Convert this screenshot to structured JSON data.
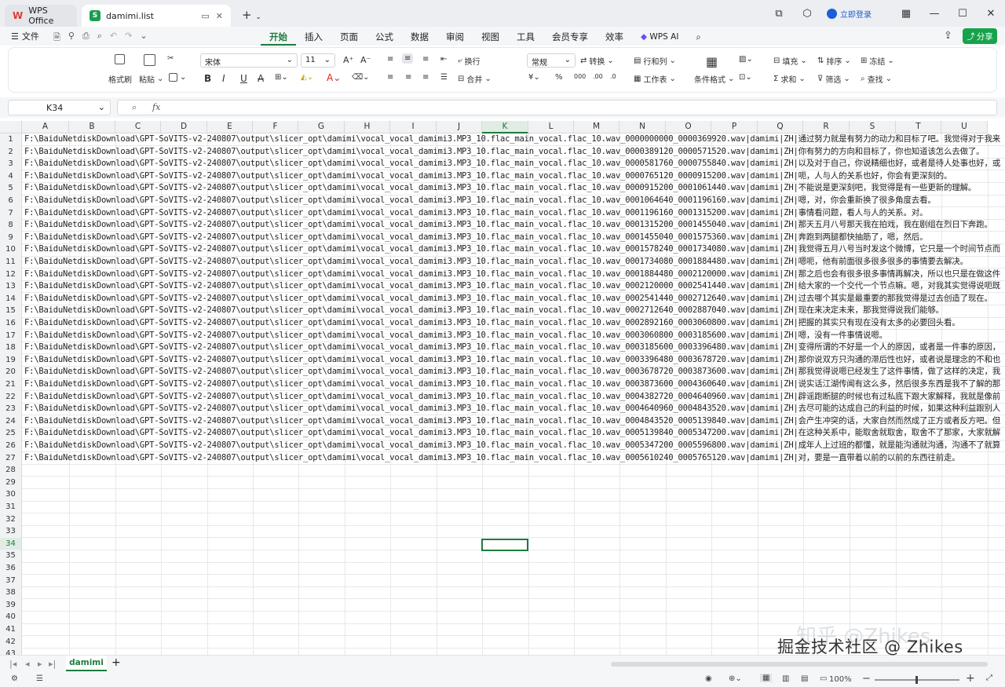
{
  "titlebar": {
    "wps_tab": "WPS Office",
    "doc_tab": "damimi.list",
    "login": "立即登录"
  },
  "menubar": {
    "file": "文件",
    "tabs": [
      "开始",
      "插入",
      "页面",
      "公式",
      "数据",
      "审阅",
      "视图",
      "工具",
      "会员专享",
      "效率",
      "WPS AI"
    ],
    "share": "分享"
  },
  "ribbon": {
    "format_painter": "格式刷",
    "paste": "粘贴",
    "font_name": "宋体",
    "font_size": "11",
    "wrap": "换行",
    "merge": "合并",
    "number_format": "常规",
    "convert": "转换",
    "row_col": "行和列",
    "worksheet": "工作表",
    "cond_format": "条件格式",
    "fill": "填充",
    "sort": "排序",
    "freeze": "冻结",
    "sum": "求和",
    "filter": "筛选",
    "find": "查找"
  },
  "formula_bar": {
    "name_box": "K34",
    "fx": "fx",
    "value": ""
  },
  "columns": [
    "A",
    "B",
    "C",
    "D",
    "E",
    "F",
    "G",
    "H",
    "I",
    "J",
    "K",
    "L",
    "M",
    "N",
    "O",
    "P",
    "Q",
    "R",
    "S",
    "T",
    "U"
  ],
  "selected_column": "K",
  "selected_row": 34,
  "rows": [
    "F:\\BaiduNetdiskDownload\\GPT-SoVITS-v2-240807\\output\\slicer_opt\\damimi\\vocal_vocal_damimi3.MP3_10.flac_main_vocal.flac_10.wav_0000000000_0000369920.wav|damimi|ZH|通过努力就是有努力的动力和目标了吧。我觉得对于我来",
    "F:\\BaiduNetdiskDownload\\GPT-SoVITS-v2-240807\\output\\slicer_opt\\damimi\\vocal_vocal_damimi3.MP3_10.flac_main_vocal.flac_10.wav_0000389120_0000571520.wav|damimi|ZH|你有努力的方向和目标了，你也知道该怎么去做了。",
    "F:\\BaiduNetdiskDownload\\GPT-SoVITS-v2-240807\\output\\slicer_opt\\damimi\\vocal_vocal_damimi3.MP3_10.flac_main_vocal.flac_10.wav_0000581760_0000755840.wav|damimi|ZH|以及对于自己，你说精细也好，或者是待人处事也好，或",
    "F:\\BaiduNetdiskDownload\\GPT-SoVITS-v2-240807\\output\\slicer_opt\\damimi\\vocal_vocal_damimi3.MP3_10.flac_main_vocal.flac_10.wav_0000765120_0000915200.wav|damimi|ZH|呃，人与人的关系也好，你会有更深刻的。",
    "F:\\BaiduNetdiskDownload\\GPT-SoVITS-v2-240807\\output\\slicer_opt\\damimi\\vocal_vocal_damimi3.MP3_10.flac_main_vocal.flac_10.wav_0000915200_0001061440.wav|damimi|ZH|不能说是更深刻吧，我觉得是有一些更新的理解。",
    "F:\\BaiduNetdiskDownload\\GPT-SoVITS-v2-240807\\output\\slicer_opt\\damimi\\vocal_vocal_damimi3.MP3_10.flac_main_vocal.flac_10.wav_0001064640_0001196160.wav|damimi|ZH|嗯，对，你会重新换了很多角度去看。",
    "F:\\BaiduNetdiskDownload\\GPT-SoVITS-v2-240807\\output\\slicer_opt\\damimi\\vocal_vocal_damimi3.MP3_10.flac_main_vocal.flac_10.wav_0001196160_0001315200.wav|damimi|ZH|事情看问题，看人与人的关系。对。",
    "F:\\BaiduNetdiskDownload\\GPT-SoVITS-v2-240807\\output\\slicer_opt\\damimi\\vocal_vocal_damimi3.MP3_10.flac_main_vocal.flac_10.wav_0001315200_0001455040.wav|damimi|ZH|那天五月八号那天我在拍戏，我在剧组在烈日下奔跑。",
    "F:\\BaiduNetdiskDownload\\GPT-SoVITS-v2-240807\\output\\slicer_opt\\damimi\\vocal_vocal_damimi3.MP3_10.flac_main_vocal.flac_10.wav_0001455040_0001575360.wav|damimi|ZH|奔跑到两腿都快抽筋了，嗯，然后。",
    "F:\\BaiduNetdiskDownload\\GPT-SoVITS-v2-240807\\output\\slicer_opt\\damimi\\vocal_vocal_damimi3.MP3_10.flac_main_vocal.flac_10.wav_0001578240_0001734080.wav|damimi|ZH|我觉得五月八号当时发这个微博，它只是一个时间节点而",
    "F:\\BaiduNetdiskDownload\\GPT-SoVITS-v2-240807\\output\\slicer_opt\\damimi\\vocal_vocal_damimi3.MP3_10.flac_main_vocal.flac_10.wav_0001734080_0001884480.wav|damimi|ZH|嗯呃，他有前面很多很多很多的事情要去解决。",
    "F:\\BaiduNetdiskDownload\\GPT-SoVITS-v2-240807\\output\\slicer_opt\\damimi\\vocal_vocal_damimi3.MP3_10.flac_main_vocal.flac_10.wav_0001884480_0002120000.wav|damimi|ZH|那之后也会有很多很多事情再解决，所以也只是在做这件",
    "F:\\BaiduNetdiskDownload\\GPT-SoVITS-v2-240807\\output\\slicer_opt\\damimi\\vocal_vocal_damimi3.MP3_10.flac_main_vocal.flac_10.wav_0002120000_0002541440.wav|damimi|ZH|给大家的一个交代一个节点嘛。嗯，对我其实觉得说呃既",
    "F:\\BaiduNetdiskDownload\\GPT-SoVITS-v2-240807\\output\\slicer_opt\\damimi\\vocal_vocal_damimi3.MP3_10.flac_main_vocal.flac_10.wav_0002541440_0002712640.wav|damimi|ZH|过去哪个其实是最重要的那我觉得是过去创造了现在。",
    "F:\\BaiduNetdiskDownload\\GPT-SoVITS-v2-240807\\output\\slicer_opt\\damimi\\vocal_vocal_damimi3.MP3_10.flac_main_vocal.flac_10.wav_0002712640_0002887040.wav|damimi|ZH|现在来决定未来，那我觉得说我们能够。",
    "F:\\BaiduNetdiskDownload\\GPT-SoVITS-v2-240807\\output\\slicer_opt\\damimi\\vocal_vocal_damimi3.MP3_10.flac_main_vocal.flac_10.wav_0002892160_0003060800.wav|damimi|ZH|把握的其实只有现在没有太多的必要回头看。",
    "F:\\BaiduNetdiskDownload\\GPT-SoVITS-v2-240807\\output\\slicer_opt\\damimi\\vocal_vocal_damimi3.MP3_10.flac_main_vocal.flac_10.wav_0003060800_0003185600.wav|damimi|ZH|嗯，没有一件事情说嗯。",
    "F:\\BaiduNetdiskDownload\\GPT-SoVITS-v2-240807\\output\\slicer_opt\\damimi\\vocal_vocal_damimi3.MP3_10.flac_main_vocal.flac_10.wav_0003185600_0003396480.wav|damimi|ZH|变得所谓的不好是一个人的原因，或者是一件事的原因，",
    "F:\\BaiduNetdiskDownload\\GPT-SoVITS-v2-240807\\output\\slicer_opt\\damimi\\vocal_vocal_damimi3.MP3_10.flac_main_vocal.flac_10.wav_0003396480_0003678720.wav|damimi|ZH|那你说双方只沟通的滞后性也好，或者说是理念的不和也",
    "F:\\BaiduNetdiskDownload\\GPT-SoVITS-v2-240807\\output\\slicer_opt\\damimi\\vocal_vocal_damimi3.MP3_10.flac_main_vocal.flac_10.wav_0003678720_0003873600.wav|damimi|ZH|那我觉得说嗯已经发生了这件事情，做了这样的决定，我",
    "F:\\BaiduNetdiskDownload\\GPT-SoVITS-v2-240807\\output\\slicer_opt\\damimi\\vocal_vocal_damimi3.MP3_10.flac_main_vocal.flac_10.wav_0003873600_0004360640.wav|damimi|ZH|说实话江湖传闻有这么多，然后很多东西是我不了解的那",
    "F:\\BaiduNetdiskDownload\\GPT-SoVITS-v2-240807\\output\\slicer_opt\\damimi\\vocal_vocal_damimi3.MP3_10.flac_main_vocal.flac_10.wav_0004382720_0004640960.wav|damimi|ZH|辟谣跑断腿的时候也有过私底下跟大家解释，我就是像前",
    "F:\\BaiduNetdiskDownload\\GPT-SoVITS-v2-240807\\output\\slicer_opt\\damimi\\vocal_vocal_damimi3.MP3_10.flac_main_vocal.flac_10.wav_0004640960_0004843520.wav|damimi|ZH|去尽可能的达成自己的利益的时候，如果这种利益跟别人",
    "F:\\BaiduNetdiskDownload\\GPT-SoVITS-v2-240807\\output\\slicer_opt\\damimi\\vocal_vocal_damimi3.MP3_10.flac_main_vocal.flac_10.wav_0004843520_0005139840.wav|damimi|ZH|会产生冲突的话，大家自然而然成了正方或者反方吧。但",
    "F:\\BaiduNetdiskDownload\\GPT-SoVITS-v2-240807\\output\\slicer_opt\\damimi\\vocal_vocal_damimi3.MP3_10.flac_main_vocal.flac_10.wav_0005139840_0005347200.wav|damimi|ZH|在这种关系中，能取舍就取舍，取舍不了那家，大家就解",
    "F:\\BaiduNetdiskDownload\\GPT-SoVITS-v2-240807\\output\\slicer_opt\\damimi\\vocal_vocal_damimi3.MP3_10.flac_main_vocal.flac_10.wav_0005347200_0005596800.wav|damimi|ZH|成年人上过班的都懂，就是能沟通就沟通，沟通不了就算",
    "F:\\BaiduNetdiskDownload\\GPT-SoVITS-v2-240807\\output\\slicer_opt\\damimi\\vocal_vocal_damimi3.MP3_10.flac_main_vocal.flac_10.wav_0005610240_0005765120.wav|damimi|ZH|对，要是一直带着以前的以前的东西往前走。"
  ],
  "sheet": {
    "tab_name": "damimi",
    "add": "+"
  },
  "status": {
    "zoom": "100%"
  },
  "watermark": {
    "line1": "知乎 @Zhikes",
    "line2": "掘金技术社区 @ Zhikes"
  }
}
